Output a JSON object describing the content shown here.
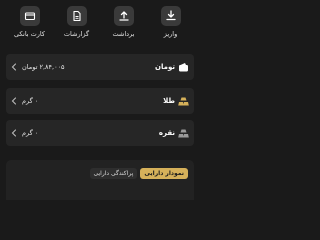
{
  "actions": [
    {
      "label": "واریز",
      "icon": "deposit-icon"
    },
    {
      "label": "برداشت",
      "icon": "withdraw-icon"
    },
    {
      "label": "گزارشات",
      "icon": "reports-icon"
    },
    {
      "label": "کارت بانکی",
      "icon": "bank-card-icon"
    }
  ],
  "assets": [
    {
      "name": "تومان",
      "value": "۲,۸۴,۰۰۵ تومان",
      "icon": "wallet-icon"
    },
    {
      "name": "طلا",
      "value": "۰ گرم",
      "icon": "gold-icon"
    },
    {
      "name": "نقره",
      "value": "۰ گرم",
      "icon": "silver-icon"
    }
  ],
  "chart_panel": {
    "tabs": [
      {
        "label": "نمودار دارایی",
        "active": true
      },
      {
        "label": "پراکندگی دارایی",
        "active": false
      }
    ]
  },
  "colors": {
    "background": "#1a1a1a",
    "card": "#262626",
    "accent_gold": "#d6b15a",
    "silver": "#9a9a9a"
  }
}
